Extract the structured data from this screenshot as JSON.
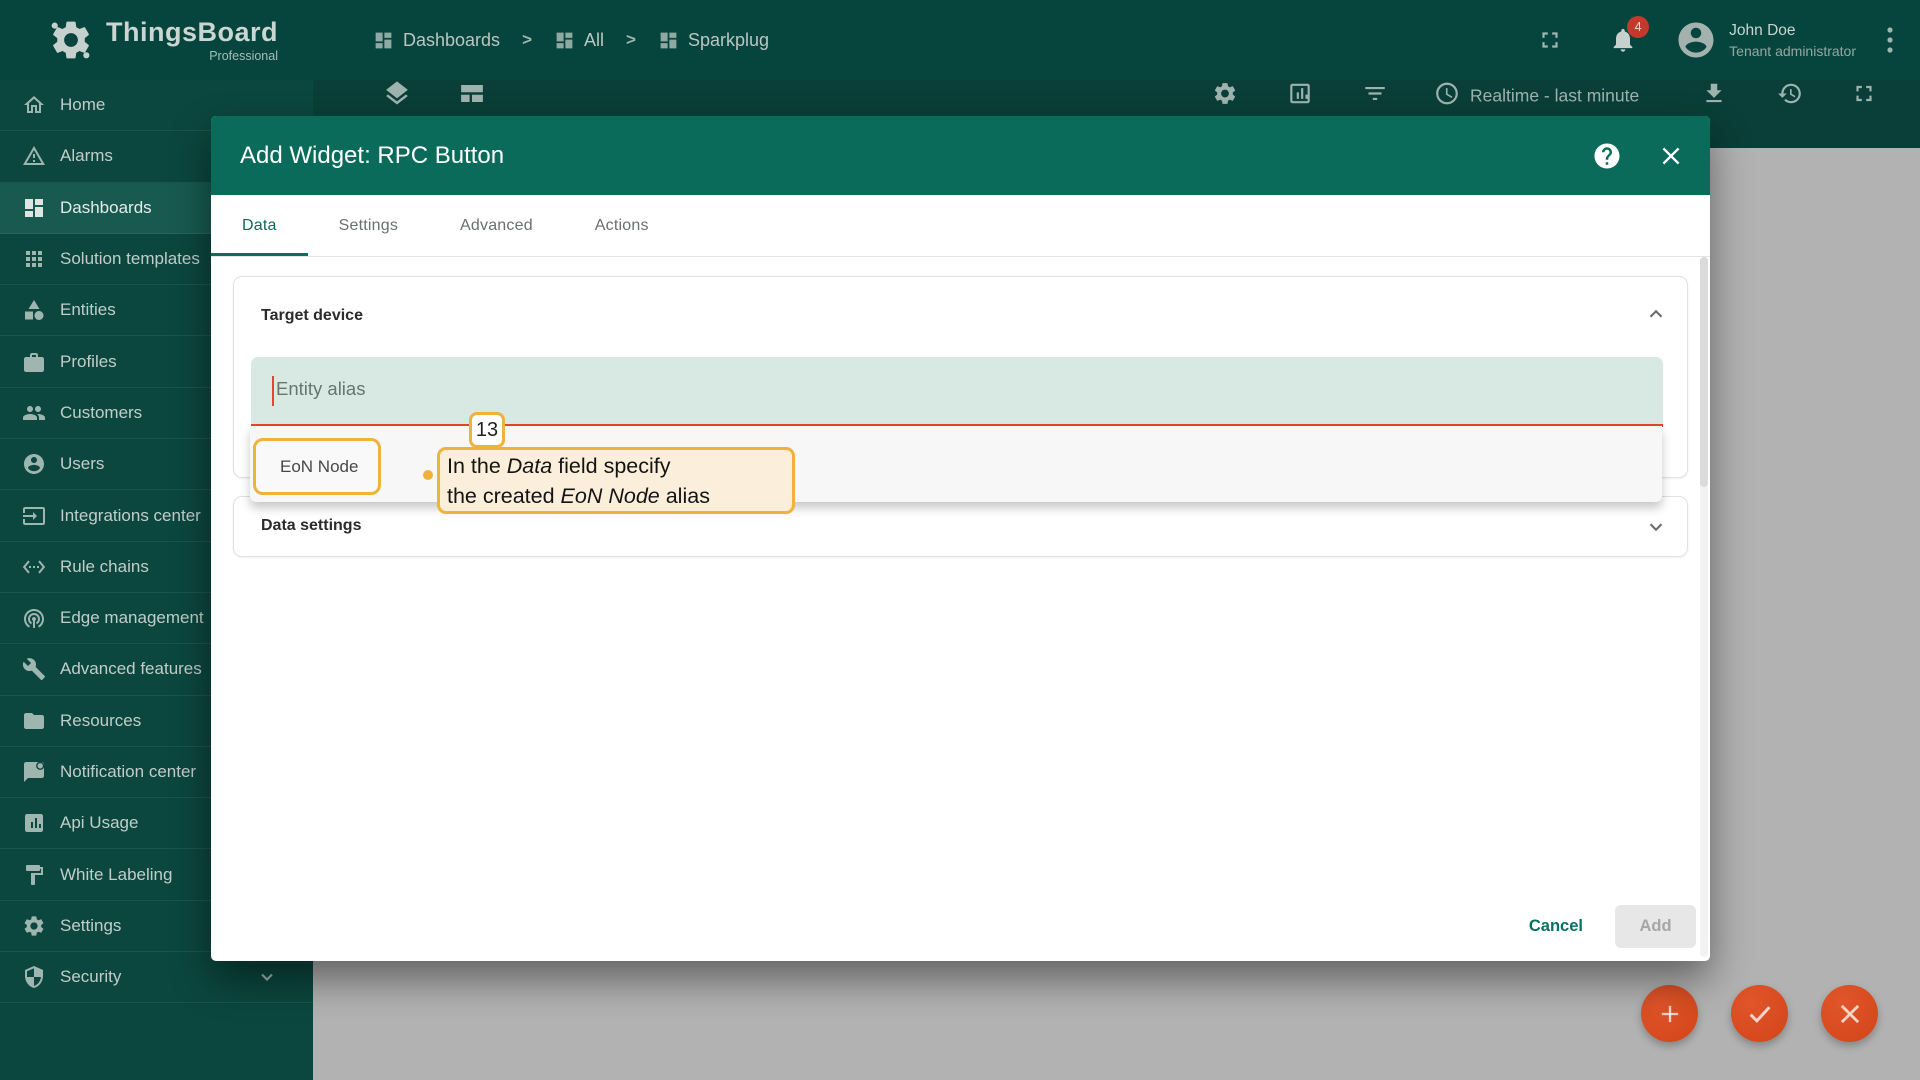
{
  "header": {
    "logo": {
      "title": "ThingsBoard",
      "subtitle": "Professional"
    },
    "breadcrumb": [
      {
        "label": "Dashboards"
      },
      {
        "label": "All"
      },
      {
        "label": "Sparkplug"
      }
    ],
    "breadcrumb_separator": ">",
    "notifications_count": "4",
    "user": {
      "name": "John Doe",
      "role": "Tenant administrator"
    }
  },
  "toolbar": {
    "timewindow": "Realtime - last minute"
  },
  "sidebar": {
    "items": [
      {
        "label": "Home"
      },
      {
        "label": "Alarms"
      },
      {
        "label": "Dashboards"
      },
      {
        "label": "Solution templates"
      },
      {
        "label": "Entities"
      },
      {
        "label": "Profiles"
      },
      {
        "label": "Customers"
      },
      {
        "label": "Users"
      },
      {
        "label": "Integrations center"
      },
      {
        "label": "Rule chains"
      },
      {
        "label": "Edge management"
      },
      {
        "label": "Advanced features"
      },
      {
        "label": "Resources"
      },
      {
        "label": "Notification center"
      },
      {
        "label": "Api Usage"
      },
      {
        "label": "White Labeling"
      },
      {
        "label": "Settings"
      },
      {
        "label": "Security"
      }
    ]
  },
  "modal": {
    "title": "Add Widget: RPC Button",
    "tabs": [
      {
        "label": "Data"
      },
      {
        "label": "Settings"
      },
      {
        "label": "Advanced"
      },
      {
        "label": "Actions"
      }
    ],
    "target_device": {
      "title": "Target device",
      "alias_placeholder": "Entity alias"
    },
    "dropdown_option": "EoN Node",
    "data_settings": {
      "title": "Data settings"
    },
    "annotation": {
      "step": "13",
      "line1": [
        "In the ",
        "Data",
        " field specify"
      ],
      "line2": [
        "the created ",
        "EoN Node",
        " alias"
      ]
    },
    "footer": {
      "cancel": "Cancel",
      "add": "Add"
    }
  },
  "colors": {
    "header_bg": "#06453D",
    "sidebar_bg": "#0B473F",
    "sidebar_selected": "#185A50",
    "dialog_header": "#0B6B5B",
    "accent_teal": "#0A6B5C",
    "input_bg": "#D8E8E3",
    "error_red": "#E8432E",
    "annotation_yellow": "#EFB23B",
    "callout_bg": "#FBEFDB",
    "fab_orange": "#D64A1E",
    "badge_red": "#C3392B"
  }
}
